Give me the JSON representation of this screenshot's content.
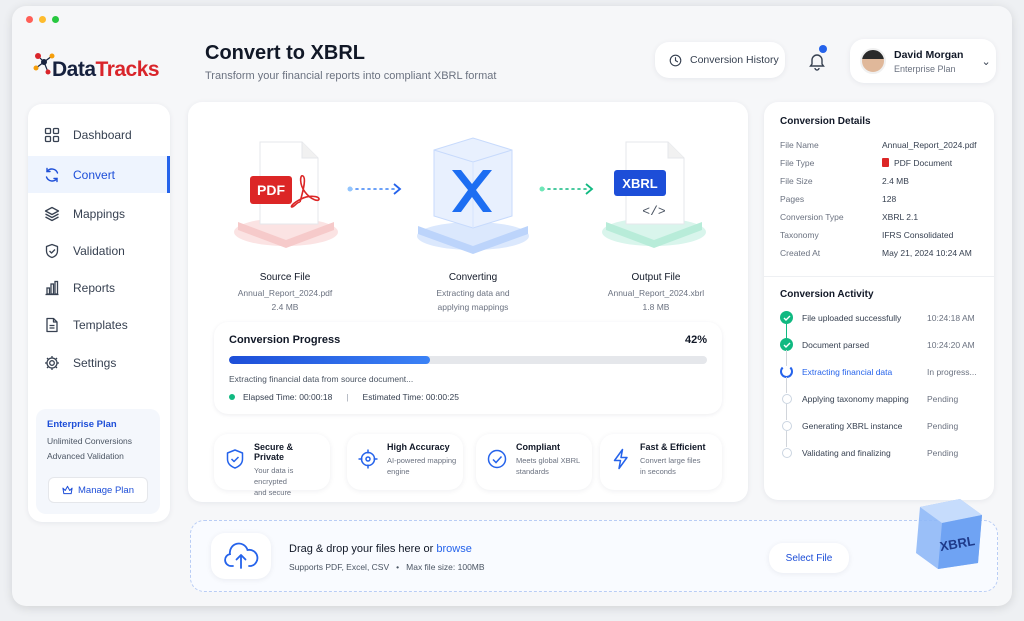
{
  "window": {
    "dot_colors": [
      "#ff5f57",
      "#febc2e",
      "#28c840"
    ]
  },
  "brand": {
    "name_part1": "Data",
    "name_part2": "Tracks"
  },
  "header": {
    "title": "Convert to XBRL",
    "subtitle": "Transform your financial reports into compliant XBRL format",
    "history_button": "Conversion History",
    "user": {
      "name": "David Morgan",
      "plan": "Enterprise Plan"
    }
  },
  "sidebar": {
    "items": [
      {
        "label": "Dashboard",
        "icon": "grid-icon"
      },
      {
        "label": "Convert",
        "icon": "refresh-icon",
        "active": true
      },
      {
        "label": "Mappings",
        "icon": "layers-icon"
      },
      {
        "label": "Validation",
        "icon": "shield-check-icon"
      },
      {
        "label": "Reports",
        "icon": "bar-chart-icon"
      },
      {
        "label": "Templates",
        "icon": "document-icon"
      },
      {
        "label": "Settings",
        "icon": "gear-icon"
      }
    ],
    "plan": {
      "title": "Enterprise Plan",
      "line1": "Unlimited Conversions",
      "line2": "Advanced Validation",
      "button": "Manage Plan"
    }
  },
  "flow": {
    "source": {
      "badge": "PDF",
      "title": "Source File",
      "file": "Annual_Report_2024.pdf",
      "size": "2.4 MB"
    },
    "converting": {
      "title": "Converting",
      "line1": "Extracting data and",
      "line2": "applying mappings"
    },
    "output": {
      "badge": "XBRL",
      "title": "Output File",
      "file": "Annual_Report_2024.xbrl",
      "size": "1.8 MB"
    }
  },
  "progress": {
    "title": "Conversion Progress",
    "percent_label": "42%",
    "percent": 42,
    "status": "Extracting financial data from source document...",
    "elapsed": "Elapsed Time: 00:00:18",
    "separator": "|",
    "estimated": "Estimated Time: 00:00:25"
  },
  "features": [
    {
      "title": "Secure & Private",
      "line1": "Your data is encrypted",
      "line2": "and secure"
    },
    {
      "title": "High Accuracy",
      "line1": "AI-powered mapping",
      "line2": "engine"
    },
    {
      "title": "Compliant",
      "line1": "Meets global XBRL",
      "line2": "standards"
    },
    {
      "title": "Fast & Efficient",
      "line1": "Convert large files",
      "line2": "in seconds"
    }
  ],
  "details": {
    "title": "Conversion Details",
    "rows": [
      {
        "key": "File Name",
        "value": "Annual_Report_2024.pdf"
      },
      {
        "key": "File Type",
        "value": "PDF Document"
      },
      {
        "key": "File Size",
        "value": "2.4 MB"
      },
      {
        "key": "Pages",
        "value": "128"
      },
      {
        "key": "Conversion Type",
        "value": "XBRL 2.1"
      },
      {
        "key": "Taxonomy",
        "value": "IFRS Consolidated"
      },
      {
        "key": "Created At",
        "value": "May 21, 2024 10:24 AM"
      }
    ]
  },
  "activity": {
    "title": "Conversion Activity",
    "items": [
      {
        "name": "File uploaded successfully",
        "time": "10:24:18 AM",
        "state": "done"
      },
      {
        "name": "Document parsed",
        "time": "10:24:20 AM",
        "state": "done"
      },
      {
        "name": "Extracting financial data",
        "time": "In progress...",
        "state": "active"
      },
      {
        "name": "Applying taxonomy mapping",
        "time": "Pending",
        "state": "pending"
      },
      {
        "name": "Generating XBRL instance",
        "time": "Pending",
        "state": "pending"
      },
      {
        "name": "Validating and finalizing",
        "time": "Pending",
        "state": "pending"
      }
    ]
  },
  "upload": {
    "title_prefix": "Drag & drop your files here or ",
    "title_link": "browse",
    "formats": "Supports PDF, Excel, CSV",
    "bullet": "•",
    "max_size": "Max file size: 100MB",
    "button": "Select File",
    "cube_label": "XBRL"
  }
}
